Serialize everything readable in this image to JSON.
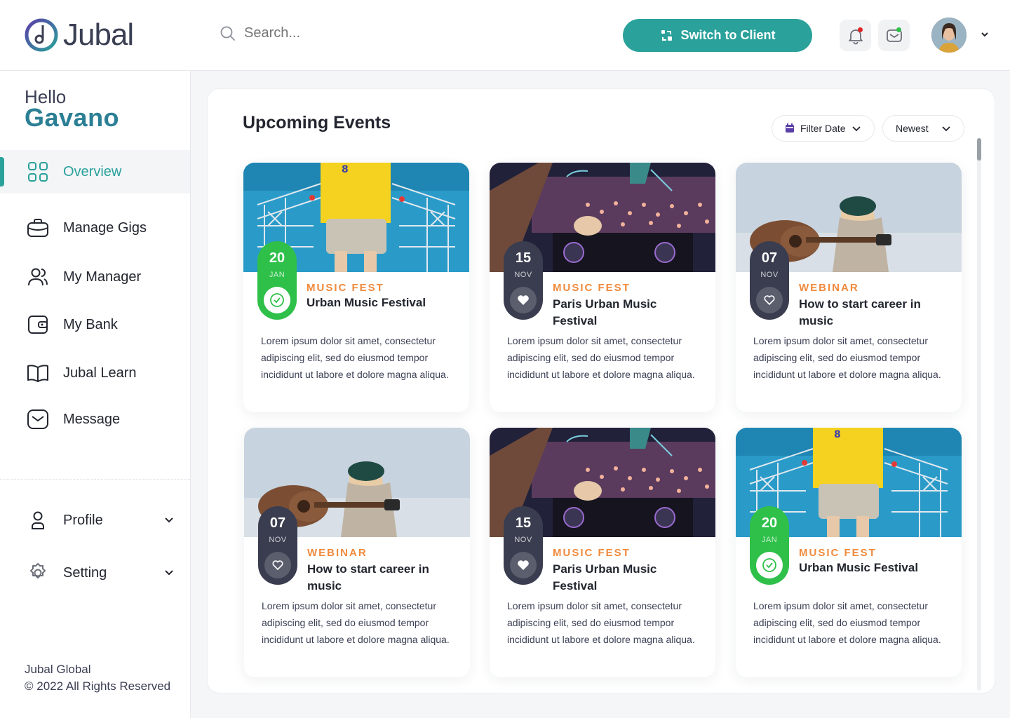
{
  "brand": {
    "name": "Jubal"
  },
  "search": {
    "placeholder": "Search..."
  },
  "header": {
    "switch_label": "Switch to Client",
    "notification_dot_color": "#e02424",
    "message_dot_color": "#2fc04a"
  },
  "greeting": {
    "hello": "Hello",
    "name": "Gavano"
  },
  "sidebar": {
    "items": [
      {
        "label": "Overview",
        "icon": "grid-icon",
        "active": true
      },
      {
        "label": "Manage Gigs",
        "icon": "briefcase-icon"
      },
      {
        "label": "My Manager",
        "icon": "users-icon"
      },
      {
        "label": "My Bank",
        "icon": "wallet-icon"
      },
      {
        "label": "Jubal Learn",
        "icon": "book-icon"
      },
      {
        "label": "Message",
        "icon": "mail-icon"
      }
    ],
    "bottom": [
      {
        "label": "Profile",
        "icon": "user-icon"
      },
      {
        "label": "Setting",
        "icon": "gear-icon"
      }
    ],
    "footer_line1": "Jubal Global",
    "footer_line2": "© 2022 All Rights Reserved"
  },
  "events": {
    "title": "Upcoming Events",
    "filter_date": "Filter Date",
    "sort": "Newest",
    "accent": "#2aa19b",
    "cards": [
      {
        "day": "20",
        "month": "JAN",
        "category": "MUSIC FEST",
        "title": "Urban Music Festival",
        "style": "green",
        "badge": "check-circle-icon",
        "image": "stage-singer",
        "description": "Lorem ipsum dolor sit amet, consectetur adipiscing elit, sed do eiusmod tempor incididunt ut labore et dolore magna aliqua."
      },
      {
        "day": "15",
        "month": "NOV",
        "category": "MUSIC FEST",
        "title": "Paris Urban Music Festival",
        "style": "dark",
        "badge": "heart-icon",
        "image": "dj-crowd",
        "description": "Lorem ipsum dolor sit amet, consectetur adipiscing elit, sed do eiusmod tempor incididunt ut labore et dolore magna aliqua."
      },
      {
        "day": "07",
        "month": "NOV",
        "category": "WEBINAR",
        "title": "How to start career in music",
        "style": "dark",
        "badge": "heart-outline-icon",
        "image": "guitarist",
        "description": "Lorem ipsum dolor sit amet, consectetur adipiscing elit, sed do eiusmod tempor incididunt ut labore et dolore magna aliqua."
      },
      {
        "day": "07",
        "month": "NOV",
        "category": "WEBINAR",
        "title": "How to start career in music",
        "style": "dark",
        "badge": "heart-outline-icon",
        "image": "guitarist",
        "description": "Lorem ipsum dolor sit amet, consectetur adipiscing elit, sed do eiusmod tempor incididunt ut labore et dolore magna aliqua."
      },
      {
        "day": "15",
        "month": "NOV",
        "category": "MUSIC FEST",
        "title": "Paris Urban Music Festival",
        "style": "dark",
        "badge": "heart-icon",
        "image": "dj-crowd",
        "description": "Lorem ipsum dolor sit amet, consectetur adipiscing elit, sed do eiusmod tempor incididunt ut labore et dolore magna aliqua."
      },
      {
        "day": "20",
        "month": "JAN",
        "category": "MUSIC FEST",
        "title": "Urban Music Festival",
        "style": "green",
        "badge": "check-circle-icon",
        "image": "stage-singer",
        "description": "Lorem ipsum dolor sit amet, consectetur adipiscing elit, sed do eiusmod tempor incididunt ut labore et dolore magna aliqua."
      }
    ]
  }
}
